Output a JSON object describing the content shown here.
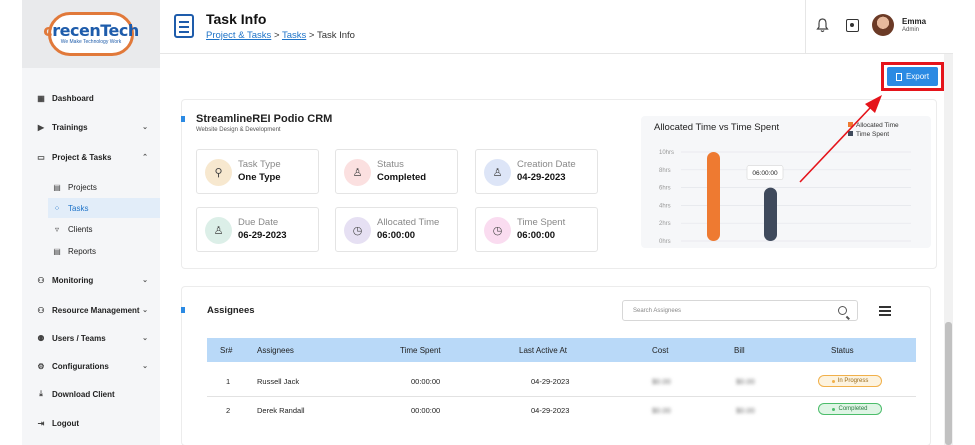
{
  "brand": {
    "name_first": "c",
    "name_rest": "recenTech",
    "tagline": "We Make Technology Work"
  },
  "sidebar": {
    "items": [
      {
        "label": "Dashboard",
        "icon": "dashboard-icon"
      },
      {
        "label": "Trainings",
        "icon": "trainings-icon"
      },
      {
        "label": "Project & Tasks",
        "icon": "project-icon"
      },
      {
        "label": "Monitoring",
        "icon": "monitoring-icon"
      },
      {
        "label": "Resource Management",
        "icon": "resource-icon"
      },
      {
        "label": "Users / Teams",
        "icon": "users-icon"
      },
      {
        "label": "Configurations",
        "icon": "config-icon"
      },
      {
        "label": "Download Client",
        "icon": "download-icon"
      },
      {
        "label": "Logout",
        "icon": "logout-icon"
      }
    ],
    "sub_items": [
      {
        "label": "Projects"
      },
      {
        "label": "Tasks",
        "active": true
      },
      {
        "label": "Clients"
      },
      {
        "label": "Reports"
      }
    ]
  },
  "header": {
    "title": "Task Info",
    "breadcrumb": {
      "crumb1": "Project & Tasks",
      "sep": ">",
      "crumb2": "Tasks",
      "current": "Task Info"
    },
    "user": {
      "name": "Emma",
      "role": "Admin"
    }
  },
  "export_label": "Export",
  "project": {
    "title": "StreamlineREI Podio CRM",
    "subtitle": "Website Design & Development",
    "tiles": [
      {
        "label": "Task Type",
        "value": "One Type"
      },
      {
        "label": "Status",
        "value": "Completed"
      },
      {
        "label": "Creation Date",
        "value": "04-29-2023"
      },
      {
        "label": "Due Date",
        "value": "06-29-2023"
      },
      {
        "label": "Allocated Time",
        "value": "06:00:00"
      },
      {
        "label": "Time Spent",
        "value": "06:00:00"
      }
    ]
  },
  "chart_data": {
    "type": "bar",
    "title": "Allocated Time vs Time Spent",
    "y_ticks": [
      "0hrs",
      "2hrs",
      "4hrs",
      "6hrs",
      "8hrs",
      "10hrs"
    ],
    "ylim": [
      0,
      10
    ],
    "series": [
      {
        "name": "Allocated Time",
        "values": [
          10
        ],
        "color": "#ee7a31"
      },
      {
        "name": "Time Spent",
        "values": [
          6
        ],
        "color": "#3f4a5c"
      }
    ],
    "tooltip": "06:00:00",
    "legend_position": "top-right",
    "grid": true
  },
  "assignees": {
    "title": "Assignees",
    "search_placeholder": "Search Assignees",
    "columns": {
      "sr": "Sr#",
      "name": "Assignees",
      "time": "Time Spent",
      "last": "Last Active At",
      "cost": "Cost",
      "bill": "Bill",
      "status": "Status"
    },
    "rows": [
      {
        "sr": "1",
        "name": "Russell Jack",
        "time": "00:00:00",
        "last": "04-29-2023",
        "cost": "$0.00",
        "bill": "$0.00",
        "status": "In Progress"
      },
      {
        "sr": "2",
        "name": "Derek Randall",
        "time": "00:00:00",
        "last": "04-29-2023",
        "cost": "$0.00",
        "bill": "$0.00",
        "status": "Completed"
      }
    ]
  },
  "colors": {
    "accent": "#2b8ae3",
    "highlight": "#e5141b",
    "allocated": "#ee7a31",
    "spent": "#3f4a5c"
  }
}
